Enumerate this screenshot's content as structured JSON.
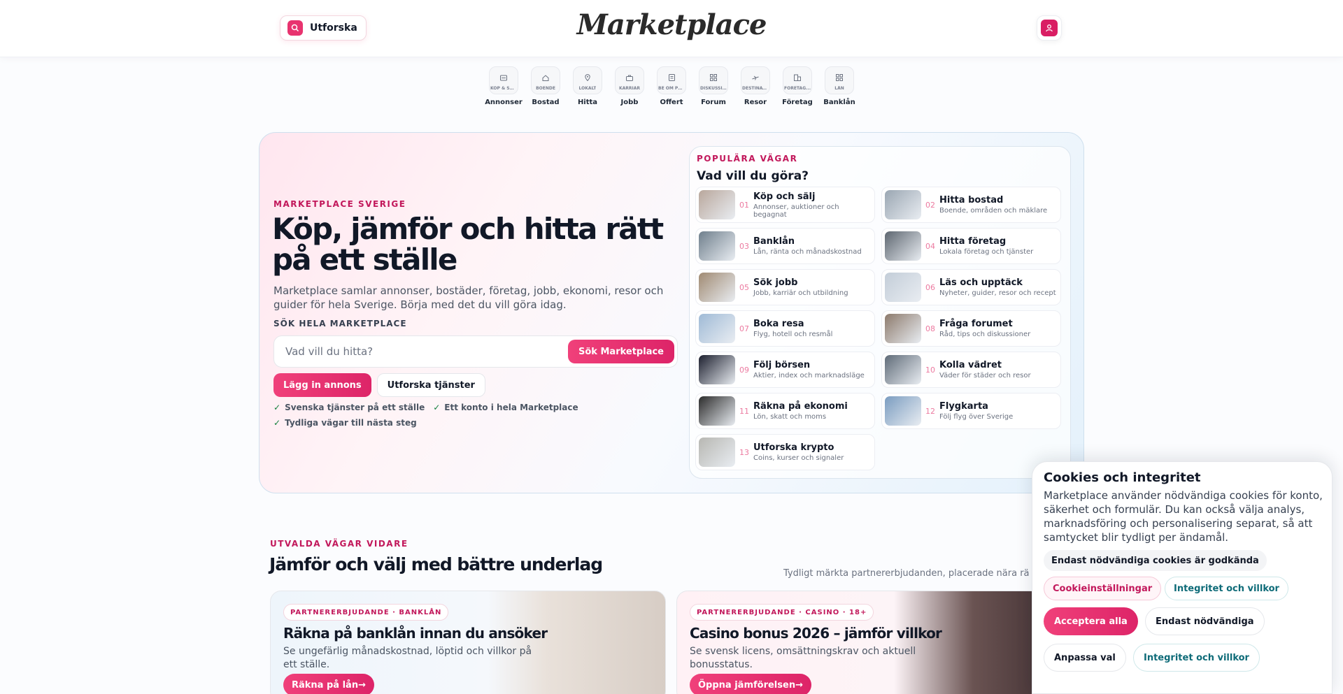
{
  "header": {
    "explore_label": "Utforska",
    "logo_text": "Marketplace"
  },
  "nav": [
    {
      "small": "KÖP & SÄLJ",
      "label": "Annonser",
      "icon": "tag-icon"
    },
    {
      "small": "BOENDE",
      "label": "Bostad",
      "icon": "house-icon"
    },
    {
      "small": "LOKALT",
      "label": "Hitta",
      "icon": "pin-icon"
    },
    {
      "small": "KARRIÄR",
      "label": "Jobb",
      "icon": "briefcase-icon"
    },
    {
      "small": "BE OM PRIS",
      "label": "Offert",
      "icon": "document-icon"
    },
    {
      "small": "DISKUSSI...",
      "label": "Forum",
      "icon": "grid-icon"
    },
    {
      "small": "DESTINAT...",
      "label": "Resor",
      "icon": "plane-icon"
    },
    {
      "small": "FÖRETAG...",
      "label": "Företag",
      "icon": "building-icon"
    },
    {
      "small": "LÅN",
      "label": "Banklån",
      "icon": "grid-icon"
    }
  ],
  "hero": {
    "eyebrow": "MARKETPLACE SVERIGE",
    "title": "Köp, jämför och hitta rätt på ett ställe",
    "description": "Marketplace samlar annonser, bostäder, företag, jobb, ekonomi, resor och guider för hela Sverige. Börja med det du vill göra idag.",
    "search_label": "SÖK HELA MARKETPLACE",
    "search_placeholder": "Vad vill du hitta?",
    "search_button": "Sök Marketplace",
    "primary_cta": "Lägg in annons",
    "secondary_cta": "Utforska tjänster",
    "checks": [
      "Svenska tjänster på ett ställe",
      "Ett konto i hela Marketplace",
      "Tydliga vägar till nästa steg"
    ]
  },
  "popular": {
    "eyebrow": "POPULÄRA VÄGAR",
    "title": "Vad vill du göra?",
    "items": [
      {
        "num": "01",
        "title": "Köp och sälj",
        "sub": "Annonser, auktioner och begagnat",
        "color": "#b9a79c"
      },
      {
        "num": "02",
        "title": "Hitta bostad",
        "sub": "Boende, områden och mäklare",
        "color": "#9aa6b2"
      },
      {
        "num": "03",
        "title": "Banklån",
        "sub": "Lån, ränta och månadskostnad",
        "color": "#6f7f8c"
      },
      {
        "num": "04",
        "title": "Hitta företag",
        "sub": "Lokala företag och tjänster",
        "color": "#5d6670"
      },
      {
        "num": "05",
        "title": "Sök jobb",
        "sub": "Jobb, karriär och utbildning",
        "color": "#a08a72"
      },
      {
        "num": "06",
        "title": "Läs och upptäck",
        "sub": "Nyheter, guider, resor och recept",
        "color": "#c3cdd8"
      },
      {
        "num": "07",
        "title": "Boka resa",
        "sub": "Flyg, hotell och resmål",
        "color": "#9fbad6"
      },
      {
        "num": "08",
        "title": "Fråga forumet",
        "sub": "Råd, tips och diskussioner",
        "color": "#8c7a6c"
      },
      {
        "num": "09",
        "title": "Följ börsen",
        "sub": "Aktier, index och marknadsläge",
        "color": "#1c1f2e"
      },
      {
        "num": "10",
        "title": "Kolla vädret",
        "sub": "Väder för städer och resor",
        "color": "#5f6b78"
      },
      {
        "num": "11",
        "title": "Räkna på ekonomi",
        "sub": "Lön, skatt och moms",
        "color": "#2b2b2b"
      },
      {
        "num": "12",
        "title": "Flygkarta",
        "sub": "Följ flyg över Sverige",
        "color": "#7a9cc0"
      },
      {
        "num": "13",
        "title": "Utforska krypto",
        "sub": "Coins, kurser och signaler",
        "color": "#b7b7b2"
      }
    ]
  },
  "section": {
    "eyebrow": "UTVALDA VÄGAR VIDARE",
    "title": "Jämför och välj med bättre underlag",
    "note": "Tydligt märkta partnererbjudanden, placerade nära rä"
  },
  "promos": [
    {
      "badge": "PARTNERERBJUDANDE · BANKLÅN",
      "title": "Räkna på banklån innan du ansöker",
      "desc": "Se ungefärlig månadskostnad, löptid och villkor på ett ställe.",
      "button": "Räkna på lån→"
    },
    {
      "badge": "PARTNERERBJUDANDE · CASINO · 18+",
      "title": "Casino bonus 2026 – jämför villkor",
      "desc": "Se svensk licens, omsättningskrav och aktuell bonusstatus.",
      "button": "Öppna jämförelsen→"
    }
  ],
  "cookie": {
    "title": "Cookies och integritet",
    "text": "Marketplace använder nödvändiga cookies för konto, säkerhet och formulär. Du kan också välja analys, marknadsföring och personalisering separat, så att samtycket blir tydligt per ändamål.",
    "note": "Endast nödvändiga cookies är godkända",
    "settings": "Cookieinställningar",
    "privacy": "Integritet och villkor",
    "accept_all": "Acceptera alla",
    "only_necessary": "Endast nödvändiga",
    "customize": "Anpassa val",
    "privacy2": "Integritet och villkor"
  },
  "colors": {
    "accent": "#e8336f",
    "brand_pink": "#c2185b",
    "teal": "#0e6b78"
  }
}
